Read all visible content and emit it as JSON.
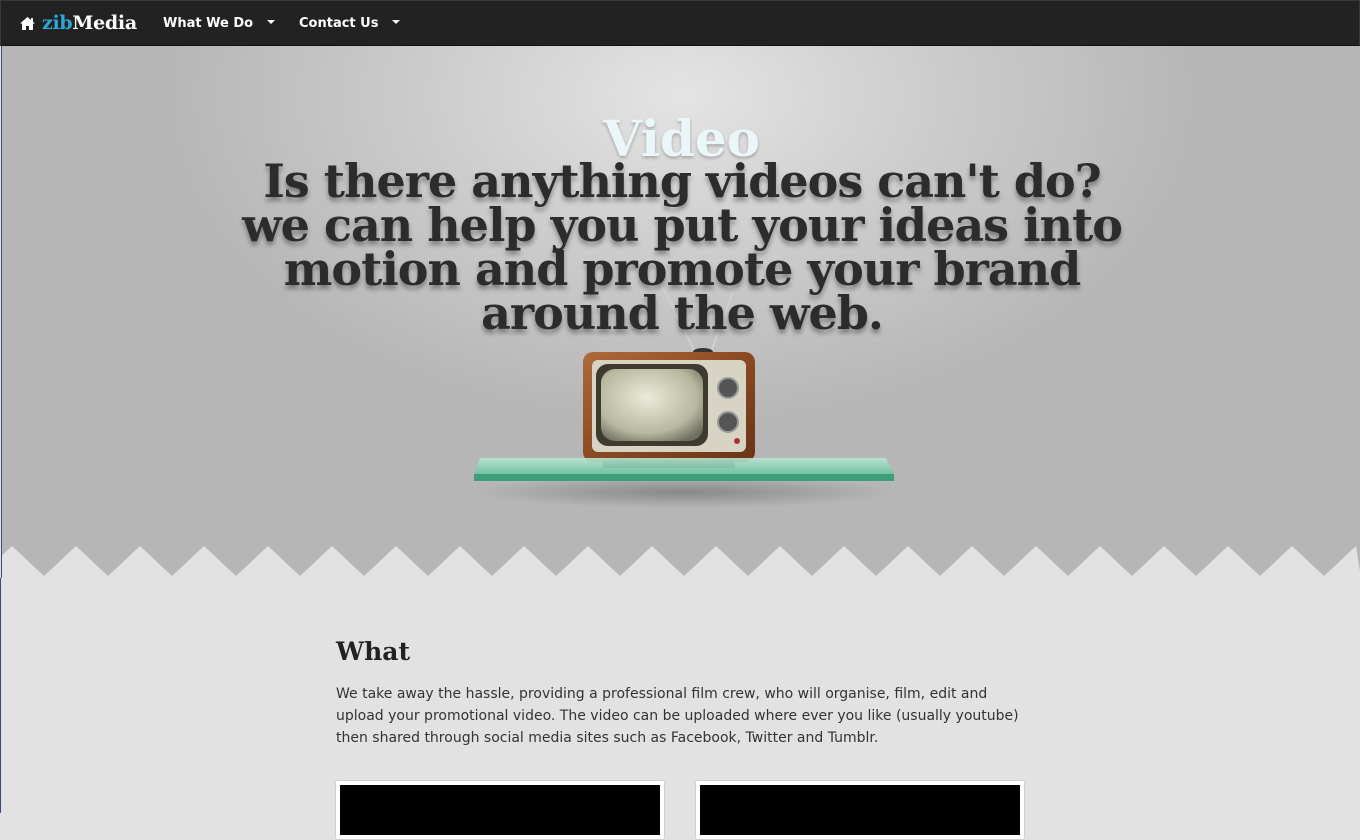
{
  "brand": {
    "name_part1": "zib",
    "name_part2": "Media",
    "icon": "home-icon"
  },
  "nav": {
    "items": [
      {
        "label": "What We Do",
        "icon": "caret-down-icon"
      },
      {
        "label": "Contact Us",
        "icon": "caret-down-icon"
      }
    ]
  },
  "hero": {
    "title": "Video",
    "tagline": "Is there anything videos can't do? we can help you put your ideas into motion and promote your brand around the web."
  },
  "content": {
    "heading": "What",
    "paragraph": "We take away the hassle, providing a professional film crew, who will organise, film, edit and upload your promotional video. The video can be uploaded where ever you like (usually youtube) then shared through social media sites such as Facebook, Twitter and Tumblr."
  },
  "colors": {
    "navbar_bg": "#222222",
    "brand_accent": "#2aa8d8",
    "hero_title": "#eaf6f8",
    "tagline": "#2c2c2c",
    "page_bg": "#e2e2e2"
  }
}
